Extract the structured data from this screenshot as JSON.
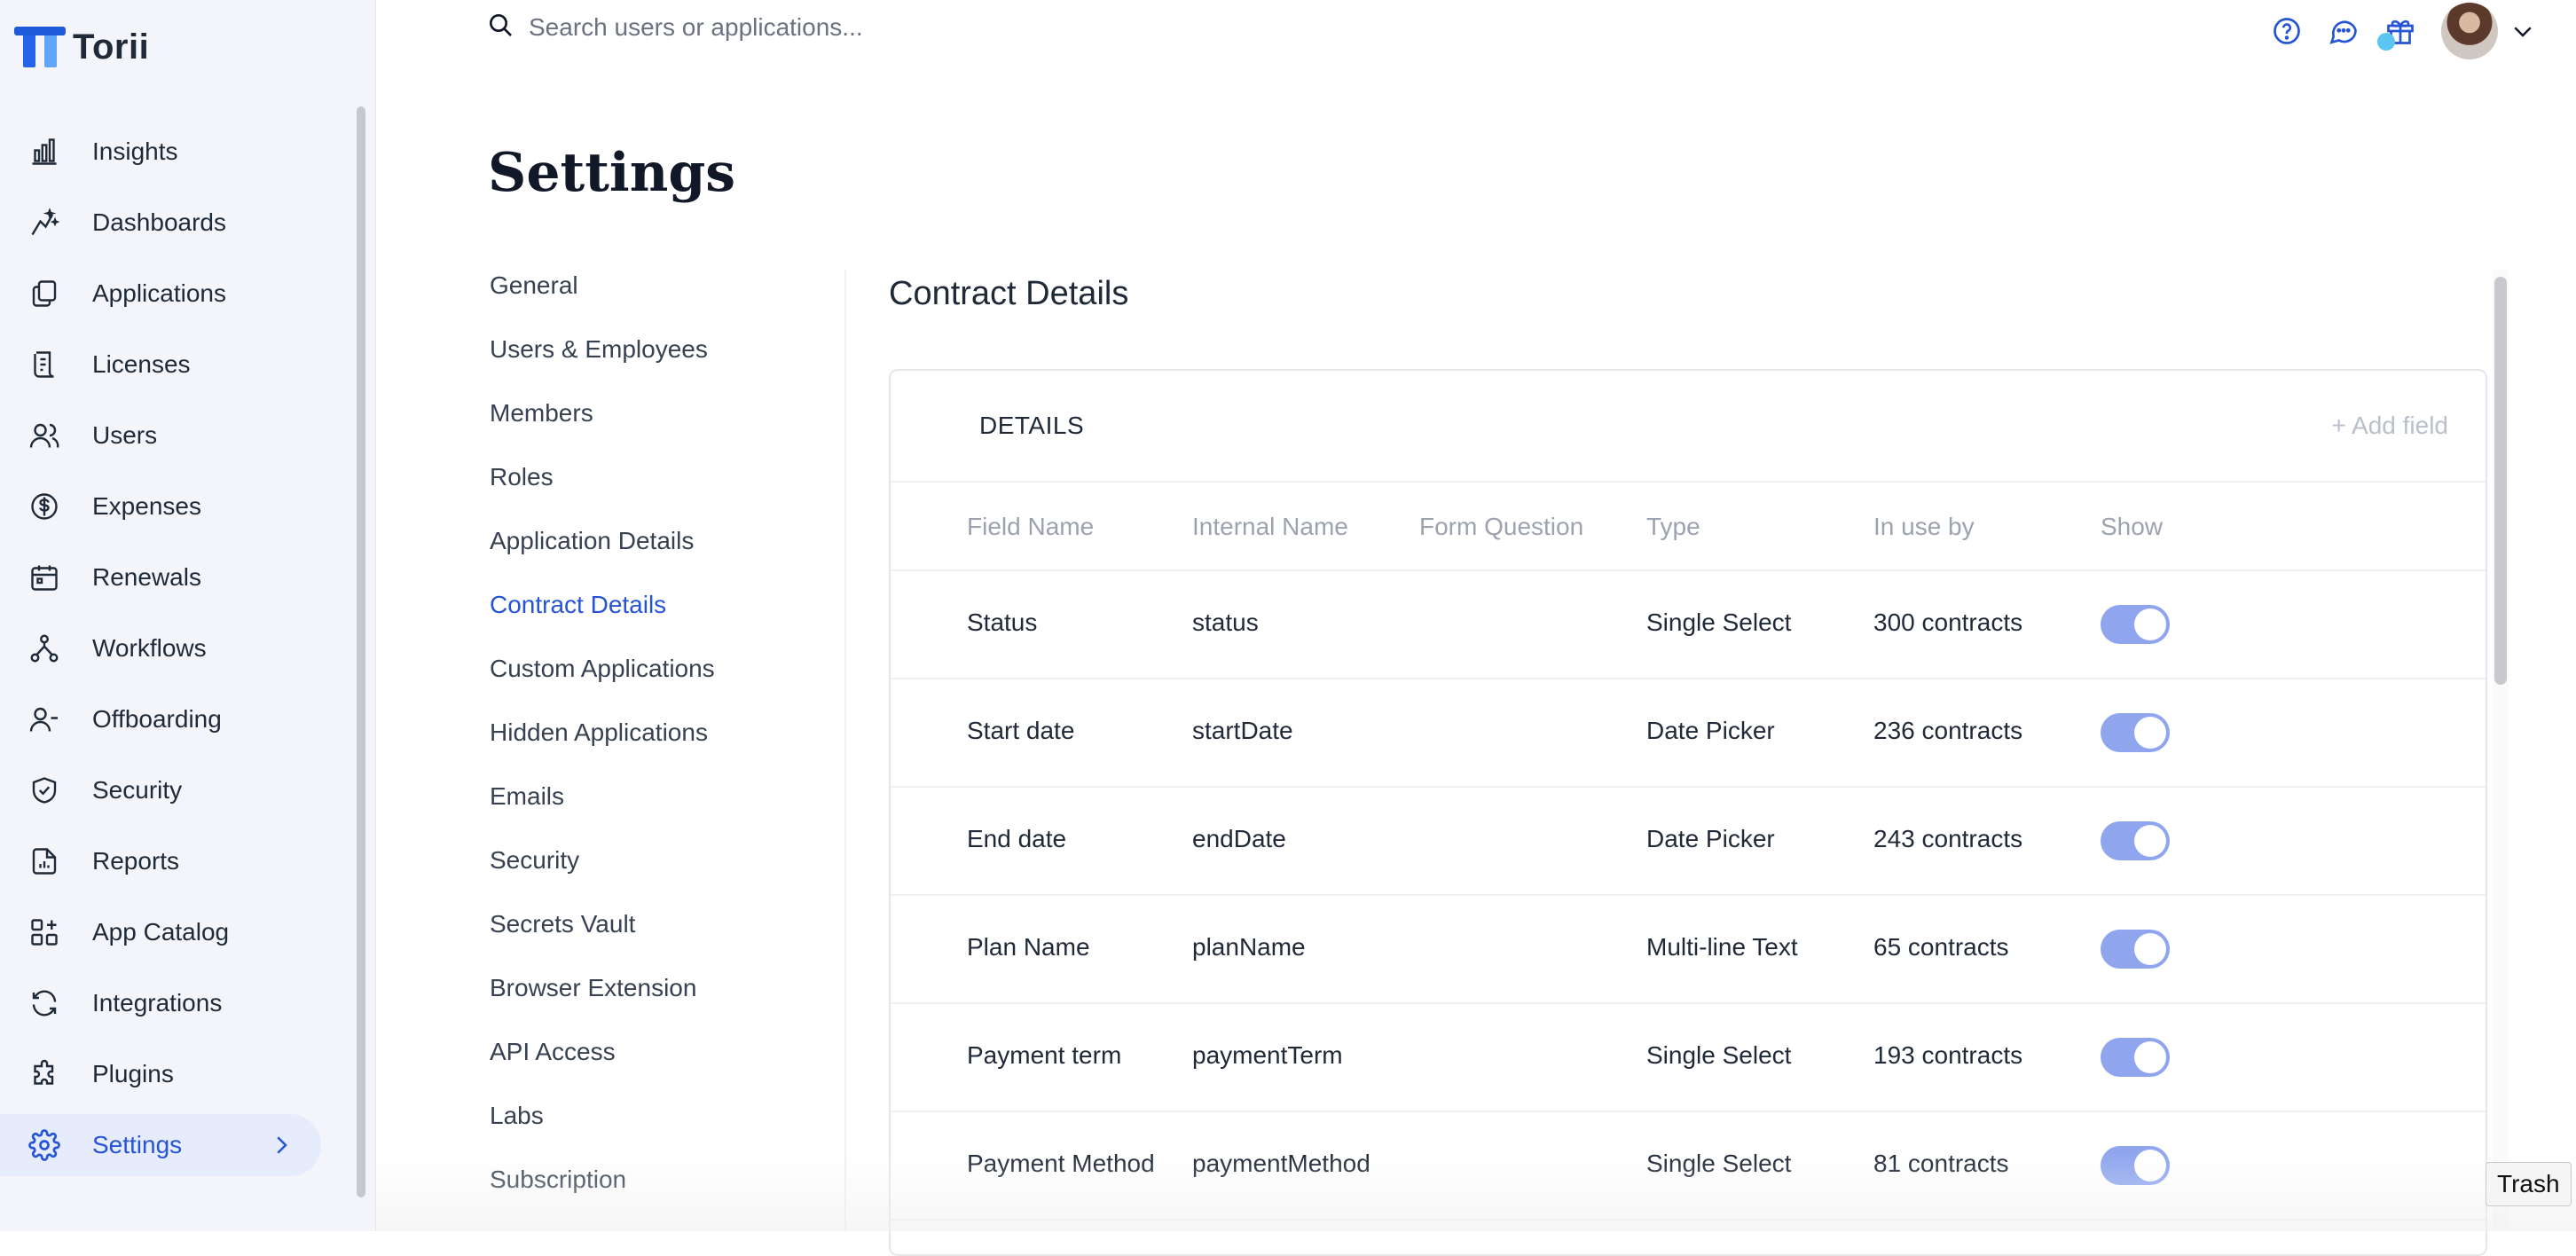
{
  "app": {
    "name": "Torii"
  },
  "search": {
    "placeholder": "Search users or applications..."
  },
  "sidebar": {
    "items": [
      {
        "label": "Insights",
        "icon": "bar-chart-icon"
      },
      {
        "label": "Dashboards",
        "icon": "sparkle-chart-icon"
      },
      {
        "label": "Applications",
        "icon": "copy-icon"
      },
      {
        "label": "Licenses",
        "icon": "receipt-icon"
      },
      {
        "label": "Users",
        "icon": "users-icon"
      },
      {
        "label": "Expenses",
        "icon": "dollar-icon"
      },
      {
        "label": "Renewals",
        "icon": "calendar-icon"
      },
      {
        "label": "Workflows",
        "icon": "workflow-icon"
      },
      {
        "label": "Offboarding",
        "icon": "user-minus-icon"
      },
      {
        "label": "Security",
        "icon": "shield-icon"
      },
      {
        "label": "Reports",
        "icon": "report-icon"
      },
      {
        "label": "App Catalog",
        "icon": "app-grid-icon"
      },
      {
        "label": "Integrations",
        "icon": "refresh-icon"
      },
      {
        "label": "Plugins",
        "icon": "puzzle-icon"
      },
      {
        "label": "Settings",
        "icon": "gear-icon",
        "active": true
      }
    ]
  },
  "page": {
    "title": "Settings"
  },
  "settings_nav": {
    "items": [
      "General",
      "Users & Employees",
      "Members",
      "Roles",
      "Application Details",
      "Contract Details",
      "Custom Applications",
      "Hidden Applications",
      "Emails",
      "Security",
      "Secrets Vault",
      "Browser Extension",
      "API Access",
      "Labs",
      "Subscription"
    ],
    "active": "Contract Details"
  },
  "section": {
    "title": "Contract Details"
  },
  "details_card": {
    "title": "DETAILS",
    "add_field_label": "+ Add field",
    "columns": [
      "Field Name",
      "Internal Name",
      "Form Question",
      "Type",
      "In use by",
      "Show"
    ],
    "rows": [
      {
        "field_name": "Status",
        "internal_name": "status",
        "form_question": "",
        "type": "Single Select",
        "in_use_by": "300 contracts",
        "show": true
      },
      {
        "field_name": "Start date",
        "internal_name": "startDate",
        "form_question": "",
        "type": "Date Picker",
        "in_use_by": "236 contracts",
        "show": true
      },
      {
        "field_name": "End date",
        "internal_name": "endDate",
        "form_question": "",
        "type": "Date Picker",
        "in_use_by": "243 contracts",
        "show": true
      },
      {
        "field_name": "Plan Name",
        "internal_name": "planName",
        "form_question": "",
        "type": "Multi-line Text",
        "in_use_by": "65 contracts",
        "show": true
      },
      {
        "field_name": "Payment term",
        "internal_name": "paymentTerm",
        "form_question": "",
        "type": "Single Select",
        "in_use_by": "193 contracts",
        "show": true
      },
      {
        "field_name": "Payment Method",
        "internal_name": "paymentMethod",
        "form_question": "",
        "type": "Single Select",
        "in_use_by": "81 contracts",
        "show": true
      }
    ]
  },
  "tooltip": {
    "text": "Trash"
  },
  "colors": {
    "accent": "#2554d6",
    "toggle_on": "#8fa6ef",
    "sidebar_bg": "#f3f5fa"
  }
}
